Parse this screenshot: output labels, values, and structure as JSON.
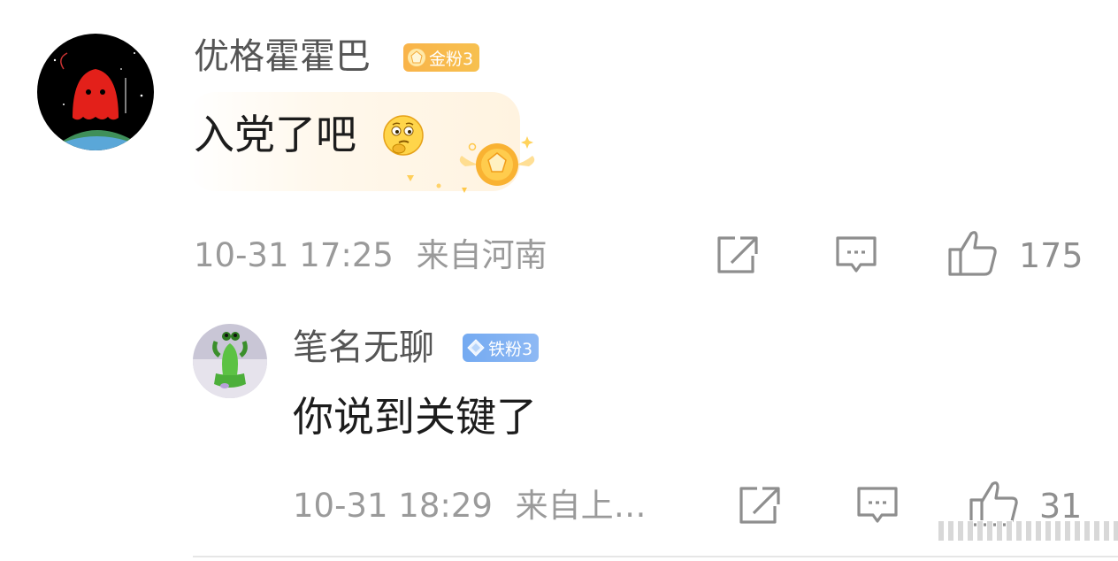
{
  "comments": [
    {
      "username": "优格霍霍巴",
      "badge": {
        "label": "金粉3",
        "color": "#f8b849"
      },
      "text": "入党了吧",
      "emoji_icon": "thinking-face-icon",
      "timestamp": "10-31 17:25",
      "location": "来自河南",
      "like_count": "175"
    },
    {
      "username": "笔名无聊",
      "badge": {
        "label": "铁粉3",
        "color": "#7aacf2"
      },
      "text": "你说到关键了",
      "timestamp": "10-31 18:29",
      "location": "来自上…",
      "like_count": "31"
    }
  ],
  "icons": {
    "share": "share-icon",
    "reply": "comment-icon",
    "like": "thumbs-up-icon"
  }
}
